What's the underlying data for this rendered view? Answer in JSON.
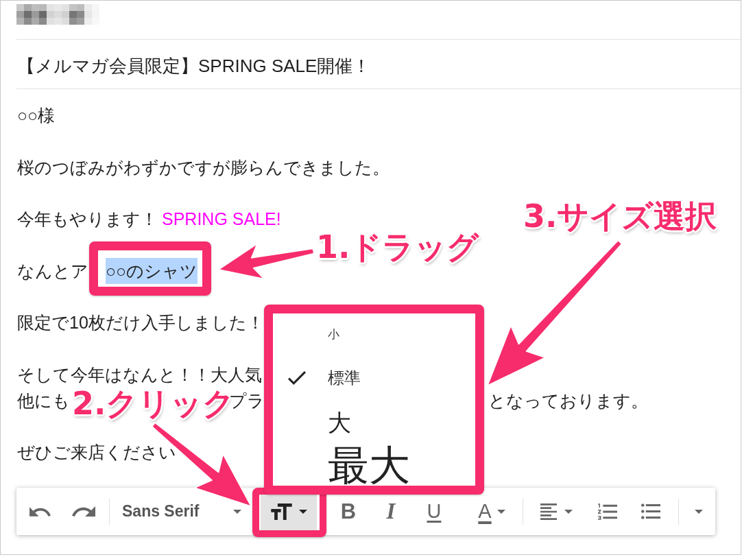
{
  "subject": "【メルマガ会員限定】SPRING SALE開催！",
  "body": [
    {
      "lines": [
        [
          {
            "kind": "plain",
            "text": "○○様"
          }
        ]
      ]
    },
    {
      "lines": [
        [
          {
            "kind": "plain",
            "text": "桜のつぼみがわずかですが膨らんできました。"
          }
        ]
      ]
    },
    {
      "lines": [
        [
          {
            "kind": "plain",
            "text": "今年もやります！"
          },
          {
            "kind": "accent",
            "text": "SPRING SALE!",
            "color": "#ff00ff"
          }
        ]
      ]
    },
    {
      "lines": [
        [
          {
            "kind": "plain",
            "text": "なんとア"
          },
          {
            "kind": "selection",
            "text": "○○のシャツ"
          }
        ]
      ]
    },
    {
      "lines": [
        [
          {
            "kind": "plain",
            "text": "限定で10枚だけ入手しました！"
          }
        ]
      ]
    },
    {
      "lines": [
        [
          {
            "kind": "plain",
            "text": "そして今年はなんと！！大人気"
          }
        ],
        [
          {
            "kind": "plain",
            "text": "他にも"
          },
          {
            "kind": "plain",
            "text": "プラ"
          },
          {
            "kind": "plain",
            "text": "となっております。"
          }
        ]
      ]
    },
    {
      "lines": [
        [
          {
            "kind": "plain",
            "text": "ぜひご来店ください"
          }
        ]
      ]
    }
  ],
  "toolbar": [
    {
      "kind": "undo",
      "pressed": false
    },
    {
      "kind": "redo",
      "pressed": false
    },
    {
      "kind": "divider"
    },
    {
      "kind": "font",
      "label": "Sans Serif",
      "pressed": false
    },
    {
      "kind": "size",
      "pressed": true
    },
    {
      "kind": "bold",
      "glyph": "B",
      "pressed": false
    },
    {
      "kind": "italic",
      "glyph": "I",
      "pressed": false
    },
    {
      "kind": "underline",
      "glyph": "U",
      "pressed": false
    },
    {
      "kind": "text_color",
      "glyph": "A",
      "pressed": false
    },
    {
      "kind": "divider"
    },
    {
      "kind": "align",
      "pressed": false
    },
    {
      "kind": "numbered_list",
      "pressed": false
    },
    {
      "kind": "bulleted_list",
      "pressed": false
    },
    {
      "kind": "divider"
    },
    {
      "kind": "more",
      "pressed": false
    }
  ],
  "size_menu": {
    "items": [
      {
        "kind": "small",
        "label": "小",
        "selected": false
      },
      {
        "kind": "normal",
        "label": "標準",
        "selected": true
      },
      {
        "kind": "large",
        "label": "大",
        "selected": false
      },
      {
        "kind": "huge",
        "label": "最大",
        "selected": false
      }
    ]
  },
  "annotations": [
    {
      "label": "1.ドラッグ"
    },
    {
      "label": "2.クリック"
    },
    {
      "label": "3.サイズ選択"
    }
  ]
}
